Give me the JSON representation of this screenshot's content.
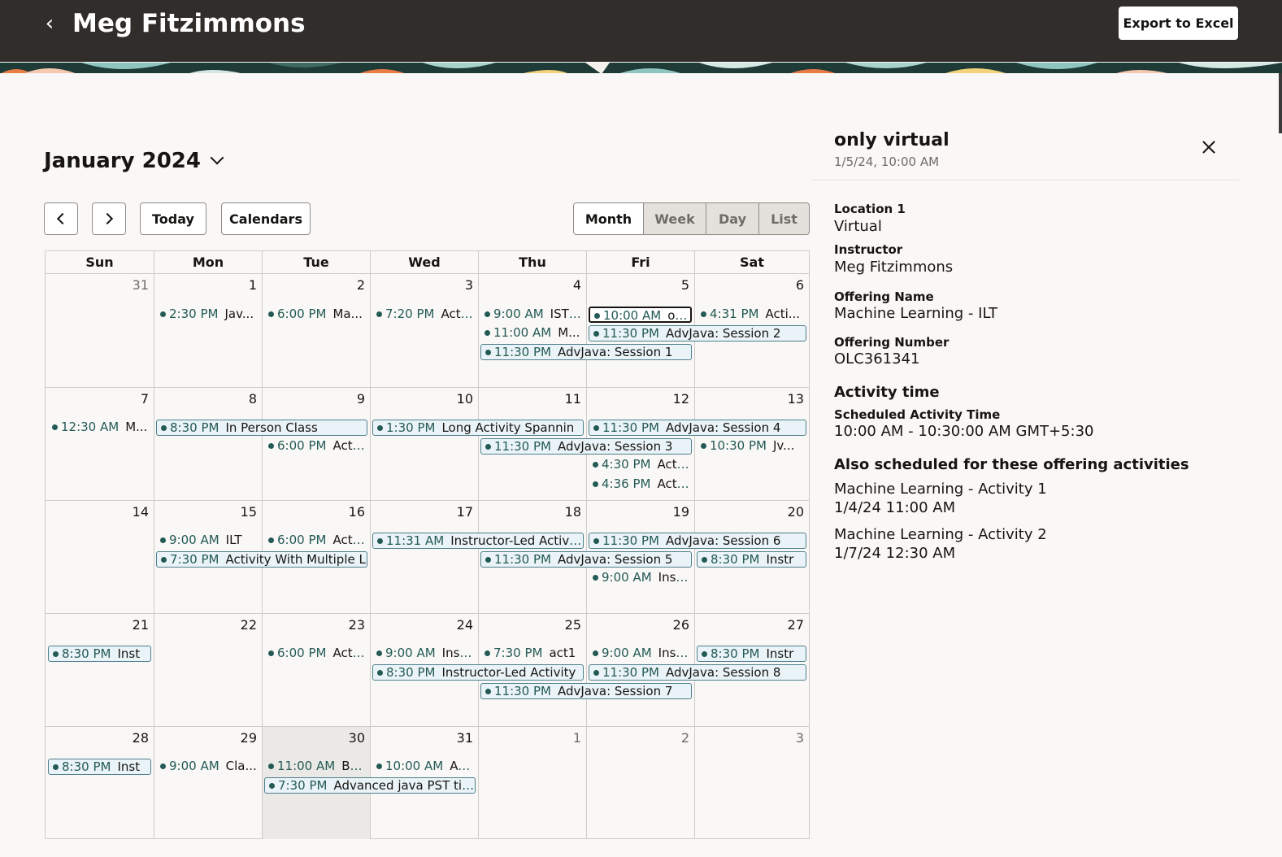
{
  "header": {
    "title": "Meg Fitzimmons",
    "export_label": "Export to Excel"
  },
  "calendar": {
    "month_title": "January 2024",
    "today_label": "Today",
    "calendars_label": "Calendars",
    "views": [
      "Month",
      "Week",
      "Day",
      "List"
    ],
    "selected_view": "Month",
    "weekdays": [
      "Sun",
      "Mon",
      "Tue",
      "Wed",
      "Thu",
      "Fri",
      "Sat"
    ],
    "weeks": [
      [
        {
          "d": "31",
          "out": true
        },
        {
          "d": "1"
        },
        {
          "d": "2"
        },
        {
          "d": "3"
        },
        {
          "d": "4"
        },
        {
          "d": "5"
        },
        {
          "d": "6"
        }
      ],
      [
        {
          "d": "7"
        },
        {
          "d": "8"
        },
        {
          "d": "9"
        },
        {
          "d": "10"
        },
        {
          "d": "11"
        },
        {
          "d": "12"
        },
        {
          "d": "13"
        }
      ],
      [
        {
          "d": "14"
        },
        {
          "d": "15"
        },
        {
          "d": "16"
        },
        {
          "d": "17"
        },
        {
          "d": "18"
        },
        {
          "d": "19"
        },
        {
          "d": "20"
        }
      ],
      [
        {
          "d": "21"
        },
        {
          "d": "22"
        },
        {
          "d": "23"
        },
        {
          "d": "24"
        },
        {
          "d": "25"
        },
        {
          "d": "26"
        },
        {
          "d": "27"
        }
      ],
      [
        {
          "d": "28"
        },
        {
          "d": "29"
        },
        {
          "d": "30",
          "today": true
        },
        {
          "d": "31"
        },
        {
          "d": "1",
          "out": true
        },
        {
          "d": "2",
          "out": true
        },
        {
          "d": "3",
          "out": true
        }
      ]
    ],
    "events": [
      {
        "w": 0,
        "c": 1,
        "span": 1,
        "row": 0,
        "time": "2:30 PM",
        "name": "Jav..."
      },
      {
        "w": 0,
        "c": 2,
        "span": 1,
        "row": 0,
        "time": "6:00 PM",
        "name": "Ma..."
      },
      {
        "w": 0,
        "c": 3,
        "span": 1,
        "row": 0,
        "time": "7:20 PM",
        "name": "Acti..."
      },
      {
        "w": 0,
        "c": 4,
        "span": 1,
        "row": 0,
        "time": "9:00 AM",
        "name": "IST ..."
      },
      {
        "w": 0,
        "c": 5,
        "span": 1,
        "row": 0,
        "time": "10:00 AM",
        "name": "on...",
        "boxed": true,
        "selected": true
      },
      {
        "w": 0,
        "c": 6,
        "span": 1,
        "row": 0,
        "time": "4:31 PM",
        "name": "Acti..."
      },
      {
        "w": 0,
        "c": 4,
        "span": 1,
        "row": 1,
        "time": "11:00 AM",
        "name": "M..."
      },
      {
        "w": 0,
        "c": 5,
        "span": 2,
        "row": 1,
        "time": "11:30 PM",
        "name": "AdvJava: Session 2",
        "boxed": true
      },
      {
        "w": 0,
        "c": 4,
        "span": 2,
        "row": 2,
        "time": "11:30 PM",
        "name": "AdvJava: Session 1",
        "boxed": true
      },
      {
        "w": 1,
        "c": 0,
        "span": 1,
        "row": 0,
        "time": "12:30 AM",
        "name": "M..."
      },
      {
        "w": 1,
        "c": 1,
        "span": 2,
        "row": 0,
        "time": "8:30 PM",
        "name": "In Person Class",
        "boxed": true
      },
      {
        "w": 1,
        "c": 3,
        "span": 2,
        "row": 0,
        "time": "1:30 PM",
        "name": "Long Activity Spannin",
        "boxed": true
      },
      {
        "w": 1,
        "c": 5,
        "span": 2,
        "row": 0,
        "time": "11:30 PM",
        "name": "AdvJava: Session 4",
        "boxed": true
      },
      {
        "w": 1,
        "c": 2,
        "span": 1,
        "row": 1,
        "time": "6:00 PM",
        "name": "Act ..."
      },
      {
        "w": 1,
        "c": 4,
        "span": 2,
        "row": 1,
        "time": "11:30 PM",
        "name": "AdvJava: Session 3",
        "boxed": true
      },
      {
        "w": 1,
        "c": 6,
        "span": 1,
        "row": 1,
        "time": "10:30 PM",
        "name": "Jv..."
      },
      {
        "w": 1,
        "c": 5,
        "span": 1,
        "row": 2,
        "time": "4:30 PM",
        "name": "Acti..."
      },
      {
        "w": 1,
        "c": 5,
        "span": 1,
        "row": 3,
        "time": "4:36 PM",
        "name": "Acti..."
      },
      {
        "w": 2,
        "c": 1,
        "span": 1,
        "row": 0,
        "time": "9:00 AM",
        "name": "ILT"
      },
      {
        "w": 2,
        "c": 2,
        "span": 1,
        "row": 0,
        "time": "6:00 PM",
        "name": "Act ..."
      },
      {
        "w": 2,
        "c": 3,
        "span": 2,
        "row": 0,
        "time": "11:31 AM",
        "name": "Instructor-Led Activity",
        "boxed": true
      },
      {
        "w": 2,
        "c": 5,
        "span": 2,
        "row": 0,
        "time": "11:30 PM",
        "name": "AdvJava: Session 6",
        "boxed": true
      },
      {
        "w": 2,
        "c": 1,
        "span": 2,
        "row": 1,
        "time": "7:30 PM",
        "name": "Activity With Multiple L",
        "boxed": true
      },
      {
        "w": 2,
        "c": 4,
        "span": 2,
        "row": 1,
        "time": "11:30 PM",
        "name": "AdvJava: Session 5",
        "boxed": true
      },
      {
        "w": 2,
        "c": 6,
        "span": 1,
        "row": 1,
        "time": "8:30 PM",
        "name": "Instr",
        "boxed": true
      },
      {
        "w": 2,
        "c": 5,
        "span": 1,
        "row": 2,
        "time": "9:00 AM",
        "name": "Inst..."
      },
      {
        "w": 3,
        "c": 0,
        "span": 1,
        "row": 0,
        "time": "8:30 PM",
        "name": "Inst",
        "boxed": true
      },
      {
        "w": 3,
        "c": 2,
        "span": 1,
        "row": 0,
        "time": "6:00 PM",
        "name": "Act ..."
      },
      {
        "w": 3,
        "c": 3,
        "span": 1,
        "row": 0,
        "time": "9:00 AM",
        "name": "Inst..."
      },
      {
        "w": 3,
        "c": 4,
        "span": 1,
        "row": 0,
        "time": "7:30 PM",
        "name": "act1"
      },
      {
        "w": 3,
        "c": 5,
        "span": 1,
        "row": 0,
        "time": "9:00 AM",
        "name": "Inst..."
      },
      {
        "w": 3,
        "c": 6,
        "span": 1,
        "row": 0,
        "time": "8:30 PM",
        "name": "Instr",
        "boxed": true
      },
      {
        "w": 3,
        "c": 3,
        "span": 2,
        "row": 1,
        "time": "8:30 PM",
        "name": "Instructor-Led Activity",
        "boxed": true
      },
      {
        "w": 3,
        "c": 5,
        "span": 2,
        "row": 1,
        "time": "11:30 PM",
        "name": "AdvJava: Session 8",
        "boxed": true
      },
      {
        "w": 3,
        "c": 4,
        "span": 2,
        "row": 2,
        "time": "11:30 PM",
        "name": "AdvJava: Session 7",
        "boxed": true
      },
      {
        "w": 4,
        "c": 0,
        "span": 1,
        "row": 0,
        "time": "8:30 PM",
        "name": "Inst",
        "boxed": true
      },
      {
        "w": 4,
        "c": 1,
        "span": 1,
        "row": 0,
        "time": "9:00 AM",
        "name": "Cla..."
      },
      {
        "w": 4,
        "c": 2,
        "span": 1,
        "row": 0,
        "time": "11:00 AM",
        "name": "Ba..."
      },
      {
        "w": 4,
        "c": 3,
        "span": 1,
        "row": 0,
        "time": "10:00 AM",
        "name": "Ac..."
      },
      {
        "w": 4,
        "c": 2,
        "span": 2,
        "row": 1,
        "time": "7:30 PM",
        "name": "Advanced java PST time",
        "boxed": true
      }
    ]
  },
  "panel": {
    "title": "only virtual",
    "subtitle": "1/5/24, 10:00 AM",
    "location_label": "Location 1",
    "location_value": "Virtual",
    "instructor_label": "Instructor",
    "instructor_value": "Meg Fitzimmons",
    "offering_name_label": "Offering Name",
    "offering_name_value": "Machine Learning - ILT",
    "offering_number_label": "Offering Number",
    "offering_number_value": "OLC361341",
    "activity_time_heading": "Activity time",
    "scheduled_label": "Scheduled Activity Time",
    "scheduled_value": "10:00 AM - 10:30:00 AM GMT+5:30",
    "also_heading": "Also scheduled for these offering activities",
    "also_items": [
      {
        "name": "Machine Learning - Activity 1",
        "date": "1/4/24 11:00 AM"
      },
      {
        "name": "Machine Learning - Activity 2",
        "date": "1/7/24 12:30 AM"
      }
    ]
  },
  "colors": {
    "header_bg": "#312d2a",
    "event_teal": "#245a55",
    "event_box_bg": "#eaf3f7"
  }
}
